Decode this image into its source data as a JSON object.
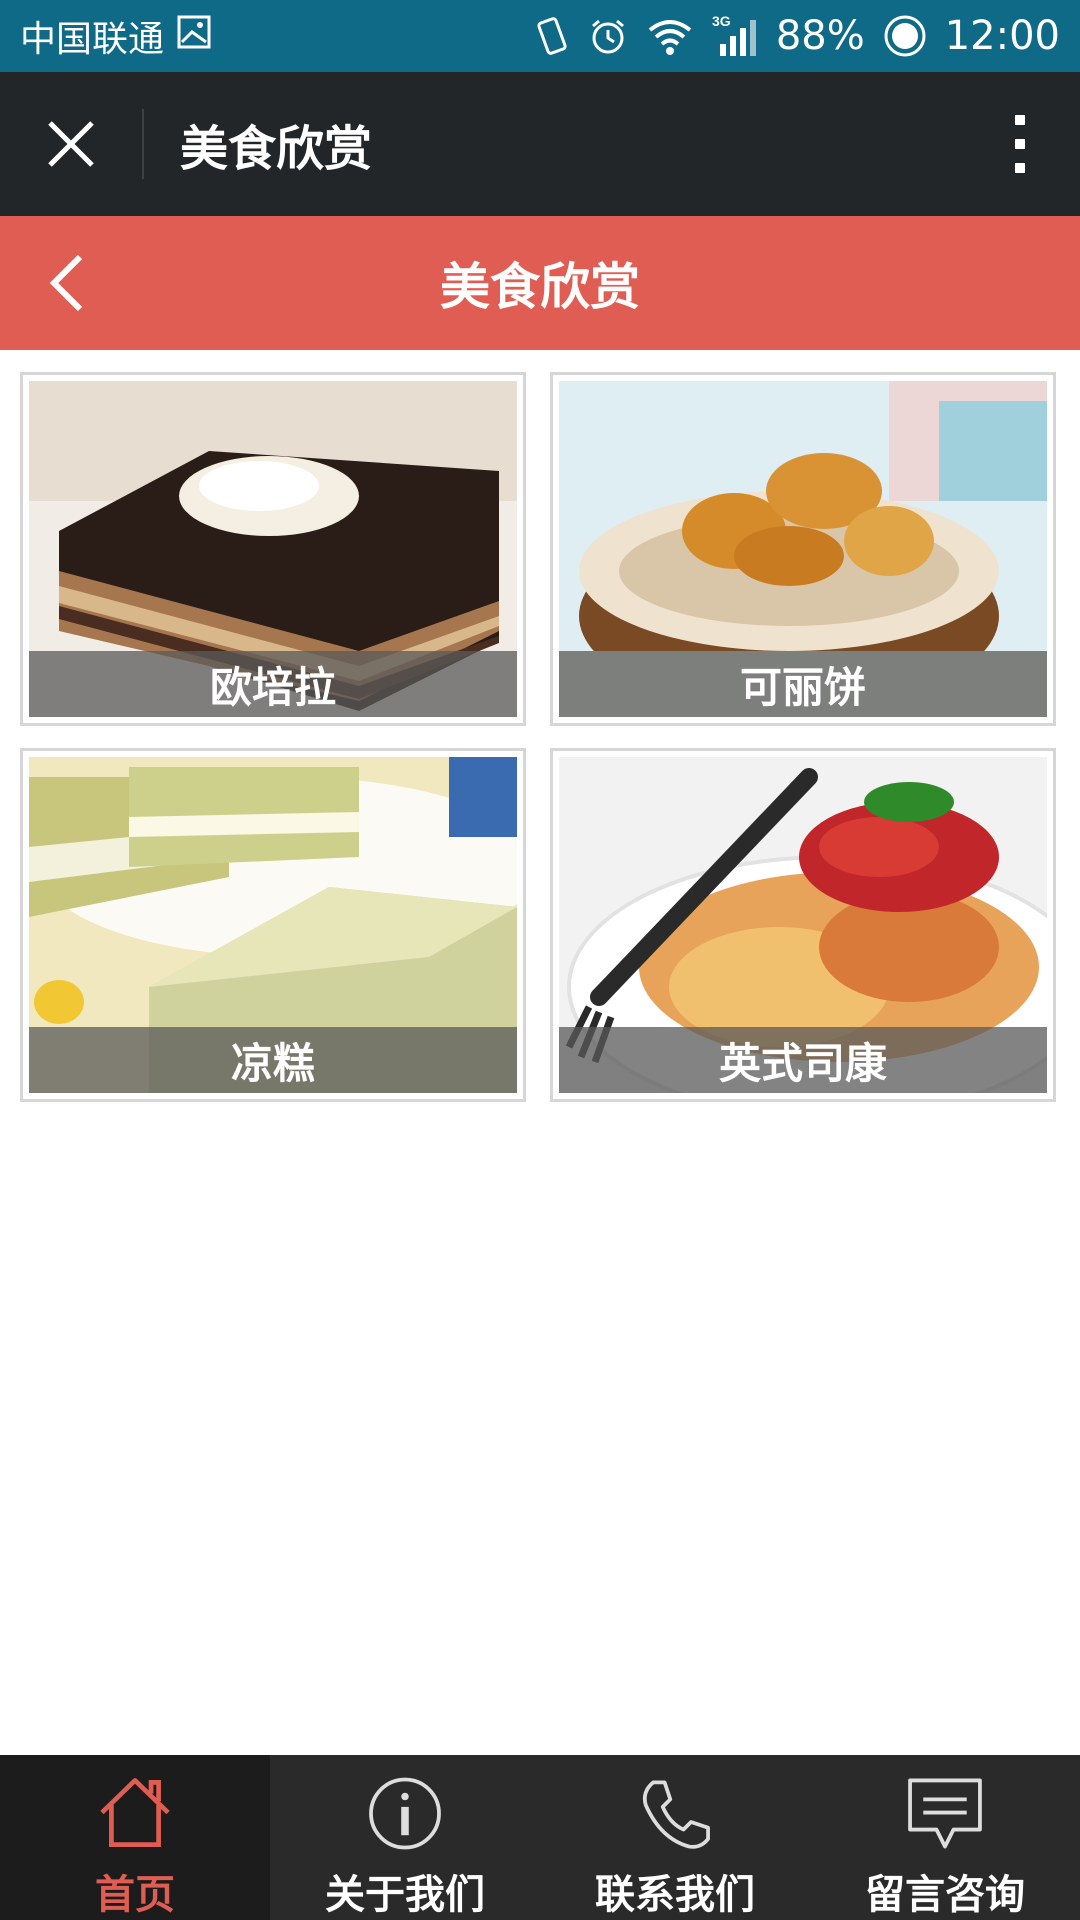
{
  "status_bar": {
    "carrier": "中国联通",
    "network": "3G",
    "battery": "88%",
    "time": "12:00"
  },
  "title_bar": {
    "title": "美食欣赏"
  },
  "header": {
    "title": "美食欣赏"
  },
  "items": [
    {
      "caption": "欧培拉",
      "icon": "cake-image"
    },
    {
      "caption": "可丽饼",
      "icon": "scone-basket-image"
    },
    {
      "caption": "凉糕",
      "icon": "layered-jelly-image"
    },
    {
      "caption": "英式司康",
      "icon": "pasta-image"
    }
  ],
  "nav": [
    {
      "label": "首页",
      "icon": "home-icon"
    },
    {
      "label": "关于我们",
      "icon": "info-icon"
    },
    {
      "label": "联系我们",
      "icon": "phone-icon"
    },
    {
      "label": "留言咨询",
      "icon": "message-icon"
    }
  ],
  "colors": {
    "status_bar": "#0e6a86",
    "title_bar": "#222629",
    "header": "#e05d53",
    "nav_bg": "#2a2a2a",
    "nav_active": "#e05d53"
  }
}
